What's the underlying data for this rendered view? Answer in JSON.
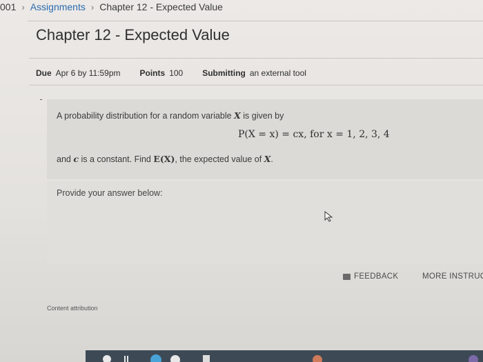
{
  "breadcrumb": {
    "course": "001",
    "assignments": "Assignments",
    "current": "Chapter 12 - Expected Value",
    "separator": "›"
  },
  "page_title": "Chapter 12 - Expected Value",
  "meta": {
    "due_label": "Due",
    "due_value": "Apr 6 by 11:59pm",
    "points_label": "Points",
    "points_value": "100",
    "submitting_label": "Submitting",
    "submitting_value": "an external tool"
  },
  "question": {
    "intro_prefix": "A probability distribution for a random variable ",
    "intro_var": "X",
    "intro_suffix": " is given by",
    "formula": "P(X = x) = cx,  for x = 1, 2, 3, 4",
    "text2_a": "and ",
    "text2_c": "c",
    "text2_b": " is a constant. Find ",
    "text2_ex": "E(X)",
    "text2_c2": ", the expected value of ",
    "text2_x": "X",
    "text2_end": "."
  },
  "answer": {
    "prompt": "Provide your answer below:"
  },
  "actions": {
    "feedback": "FEEDBACK",
    "more_instructions": "MORE INSTRUC"
  },
  "footer": {
    "content_attribution": "Content attribution"
  },
  "colors": {
    "link": "#2b6cb0",
    "taskbar": "#3d4a56"
  }
}
